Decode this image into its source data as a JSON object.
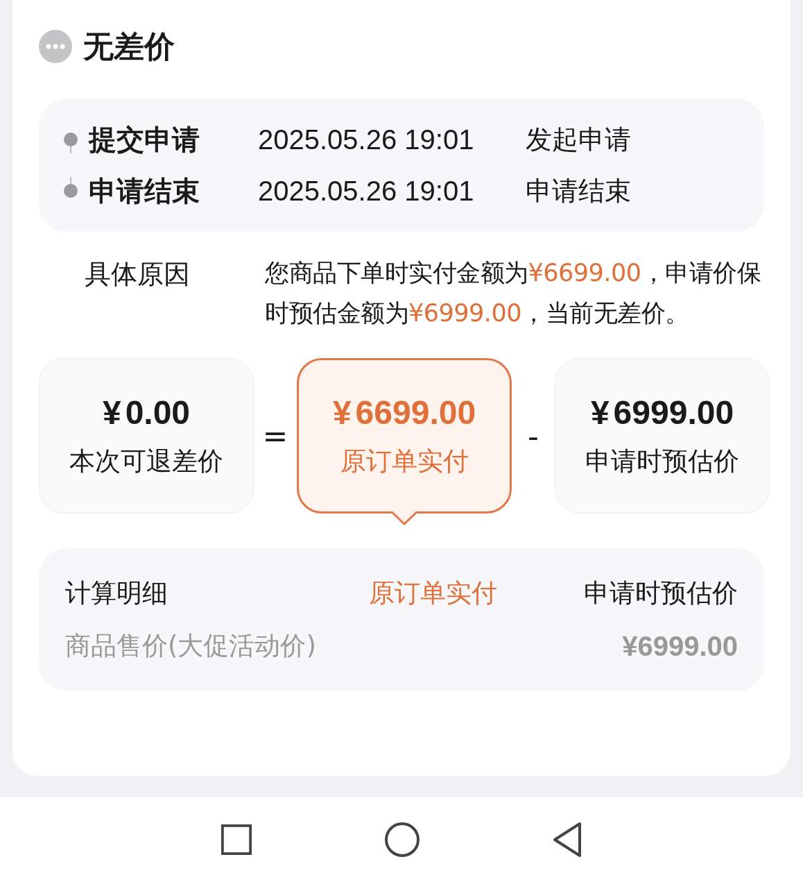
{
  "header": {
    "title": "无差价"
  },
  "timeline": [
    {
      "label": "提交申请",
      "time": "2025.05.26 19:01",
      "status": "发起申请"
    },
    {
      "label": "申请结束",
      "time": "2025.05.26 19:01",
      "status": "申请结束"
    }
  ],
  "reason": {
    "label": "具体原因",
    "segments": [
      {
        "text": "您商品下单时实付金额为",
        "kind": "plain"
      },
      {
        "text": "¥6699.00",
        "kind": "amount"
      },
      {
        "text": "，申请价保时预估金额为",
        "kind": "plain"
      },
      {
        "text": "¥6999.00",
        "kind": "amount"
      },
      {
        "text": "，当前无差价。",
        "kind": "plain"
      }
    ]
  },
  "formula": [
    {
      "kind": "box",
      "amount": "¥0.00",
      "label": "本次可退差价",
      "selected": false
    },
    {
      "kind": "operator",
      "symbol": "="
    },
    {
      "kind": "box",
      "amount": "¥6699.00",
      "label": "原订单实付",
      "selected": true
    },
    {
      "kind": "operator",
      "symbol": "-"
    },
    {
      "kind": "box",
      "amount": "¥6999.00",
      "label": "申请时预估价",
      "selected": false
    }
  ],
  "details": {
    "title": "计算明细",
    "columns": [
      {
        "label": "原订单实付",
        "selected": true
      },
      {
        "label": "申请时预估价",
        "selected": false
      }
    ],
    "rows": [
      {
        "name": "商品售价(大促活动价)",
        "price": "¥6999.00"
      }
    ]
  }
}
